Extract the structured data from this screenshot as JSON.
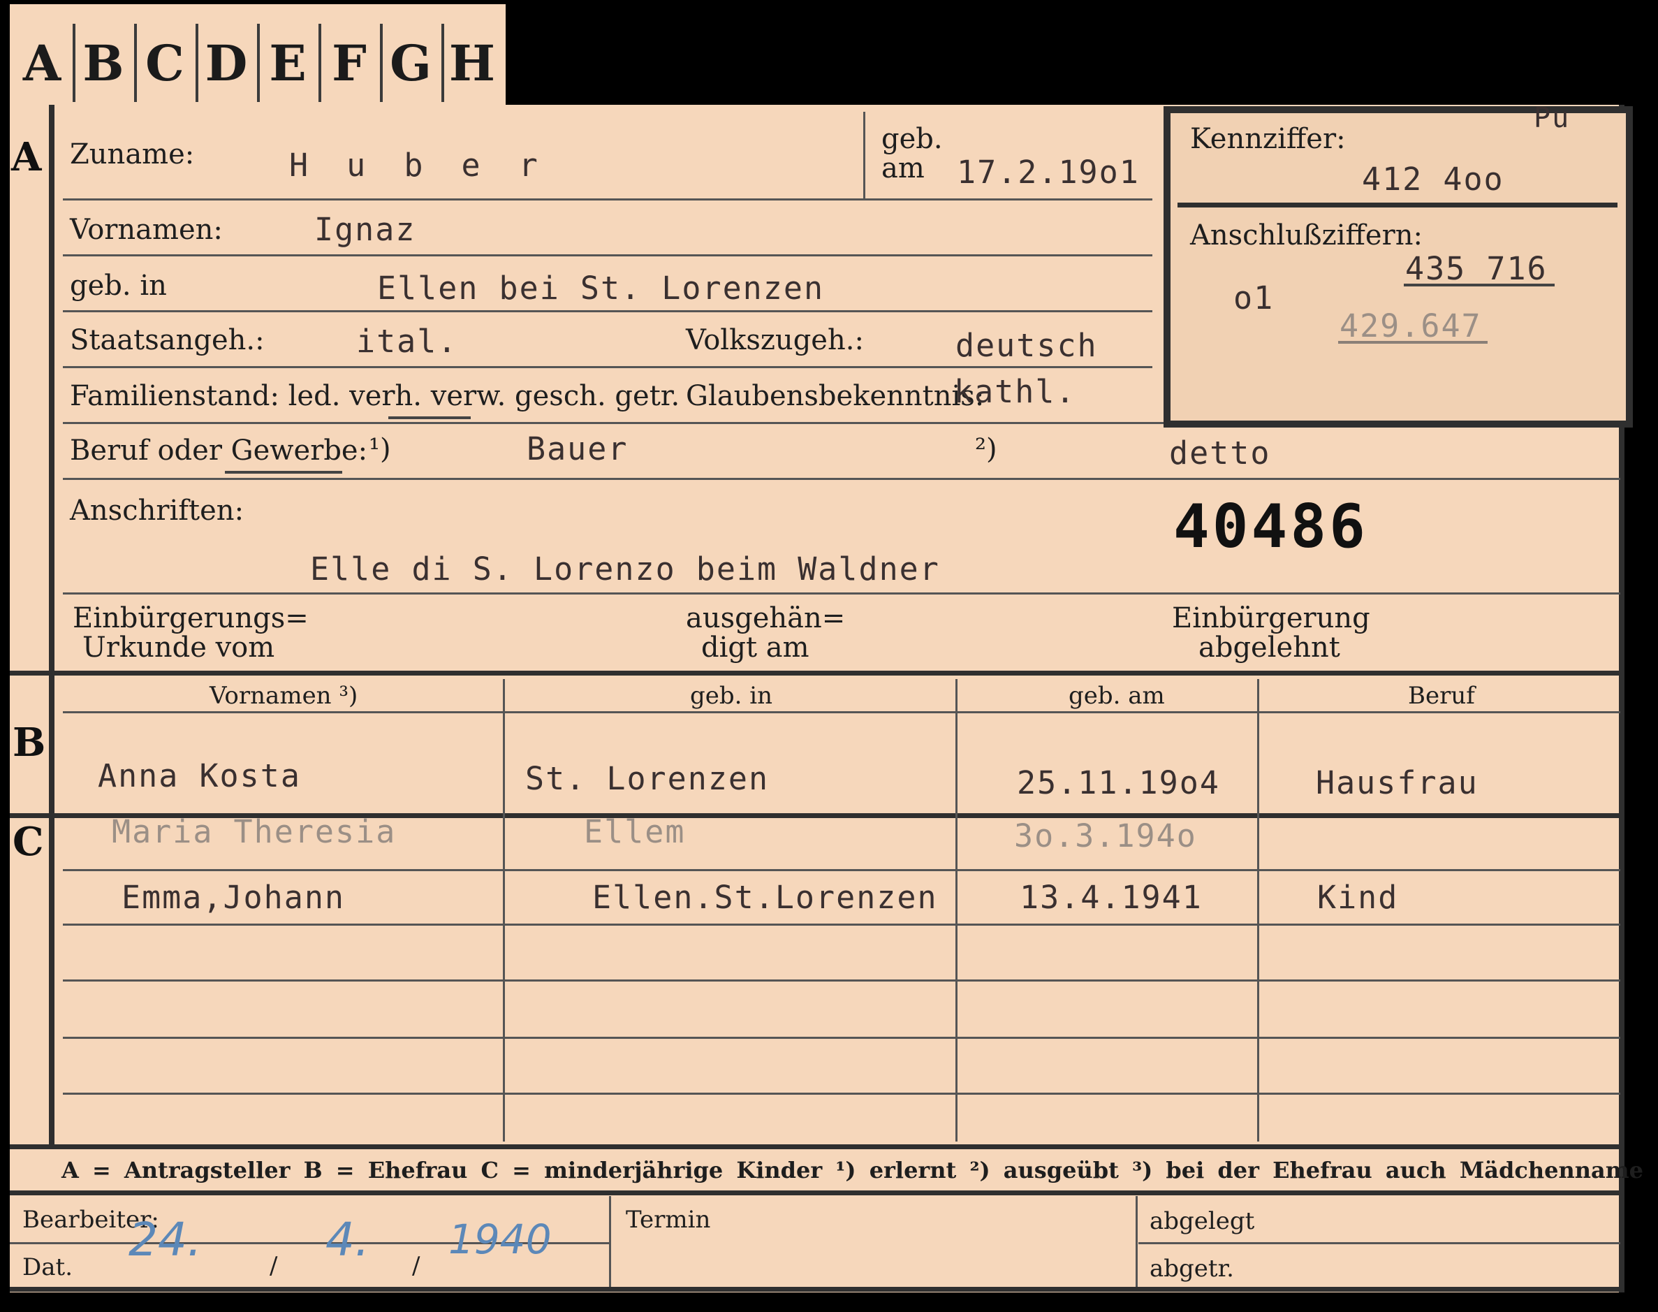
{
  "tabs": [
    "A",
    "B",
    "C",
    "D",
    "E",
    "F",
    "G",
    "H"
  ],
  "sections": {
    "a": "A",
    "b": "B",
    "c": "C"
  },
  "labels": {
    "zuname": "Zuname:",
    "geb_am_line1": "geb.",
    "geb_am_line2": "am",
    "kennziffer": "Kennziffer:",
    "vornamen": "Vornamen:",
    "anschlussziffern": "Anschlußziffern:",
    "geb_in": "geb. in",
    "staatsangeh": "Staatsangeh.:",
    "volkszugeh": "Volkszugeh.:",
    "familienstand": "Familienstand: led. verh. verw. gesch. getr.",
    "glaubensbekenntnis": "Glaubensbekenntnis:",
    "beruf_oder_gewerbe": "Beruf oder Gewerbe:",
    "footnote1_mark": "¹)",
    "footnote2_mark": "²)",
    "anschriften": "Anschriften:",
    "einbuergerungs_line1": "Einbürgerungs=",
    "einbuergerungs_line2": "Urkunde vom",
    "ausgehaen_line1": "ausgehän=",
    "ausgehaen_line2": "digt am",
    "einbuergerung_line1": "Einbürgerung",
    "einbuergerung_line2": "abgelehnt"
  },
  "applicant": {
    "surname": "H u b e r",
    "birth_date": "17.2.19o1",
    "kennziffer": "412 4oo",
    "kennziffer_note": "Pu",
    "first_names": "Ignaz",
    "anschluss_prefix": "o1",
    "anschluss_1": "435 716",
    "anschluss_2": "429.647",
    "birth_place": "Ellen bei St. Lorenzen",
    "citizenship": "ital.",
    "ethnicity": "deutsch",
    "religion": "kathl.",
    "occupation_learned": "Bauer",
    "occupation_practiced": "detto",
    "address": "Elle di S. Lorenzo beim Waldner",
    "file_number": "40486"
  },
  "family_table": {
    "headers": [
      "Vornamen ³)",
      "geb. in",
      "geb. am",
      "Beruf"
    ],
    "wife": {
      "first_names": "Anna Kosta",
      "birth_place": "St. Lorenzen",
      "birth_date": "25.11.19o4",
      "occupation": "Hausfrau"
    },
    "children": [
      {
        "first_names": "Maria Theresia",
        "birth_place": "Ellem",
        "birth_date": "3o.3.194o",
        "occupation": ""
      },
      {
        "first_names": "Emma,Johann",
        "birth_place": "Ellen.St.Lorenzen",
        "birth_date": "13.4.1941",
        "occupation": "Kind"
      }
    ]
  },
  "legend": "A = Antragsteller   B = Ehefrau   C = minderjährige Kinder   ¹) erlernt   ²) ausgeübt   ³) bei der Ehefrau auch Mädchenname",
  "footer": {
    "bearbeiter": "Bearbeiter:",
    "dat": "Dat.",
    "date_day": "24.",
    "date_sep1": "/",
    "date_month": "4.",
    "date_sep2": "/",
    "date_year": "1940",
    "termin": "Termin",
    "abgelegt": "abgelegt",
    "abgetr": "abgetr."
  },
  "colors": {
    "card": "#f6d7bb",
    "lines": "#555555",
    "ink": "#5c88b8",
    "background": "#000000"
  }
}
